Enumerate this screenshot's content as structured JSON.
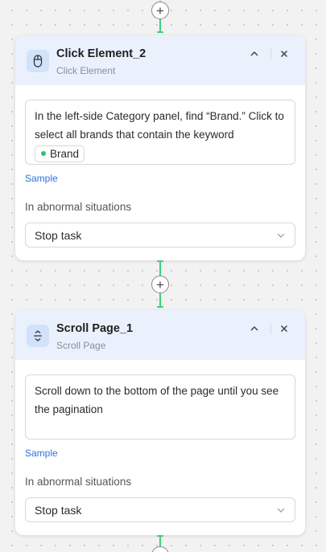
{
  "flow": {
    "steps": [
      {
        "title": "Click Element_2",
        "type": "Click Element",
        "icon": "mouse-icon",
        "description_text": "In the left-side Category panel, find “Brand.” Click to select all brands that contain the keyword",
        "keyword_chip": "Brand",
        "sample_label": "Sample",
        "abnormal_label": "In abnormal situations",
        "abnormal_value": "Stop task"
      },
      {
        "title": "Scroll Page_1",
        "type": "Scroll Page",
        "icon": "scroll-icon",
        "description_text": "Scroll down to the bottom of the page until you see the pagination",
        "sample_label": "Sample",
        "abnormal_label": "In abnormal situations",
        "abnormal_value": "Stop task"
      }
    ],
    "add_button_glyph": "+"
  },
  "colors": {
    "canvas": "#f2f2f2",
    "header": "#eaf1fd",
    "icon_bg": "#d2e2fb",
    "connector_active": "#3ecf7a",
    "link": "#2a73e0"
  }
}
